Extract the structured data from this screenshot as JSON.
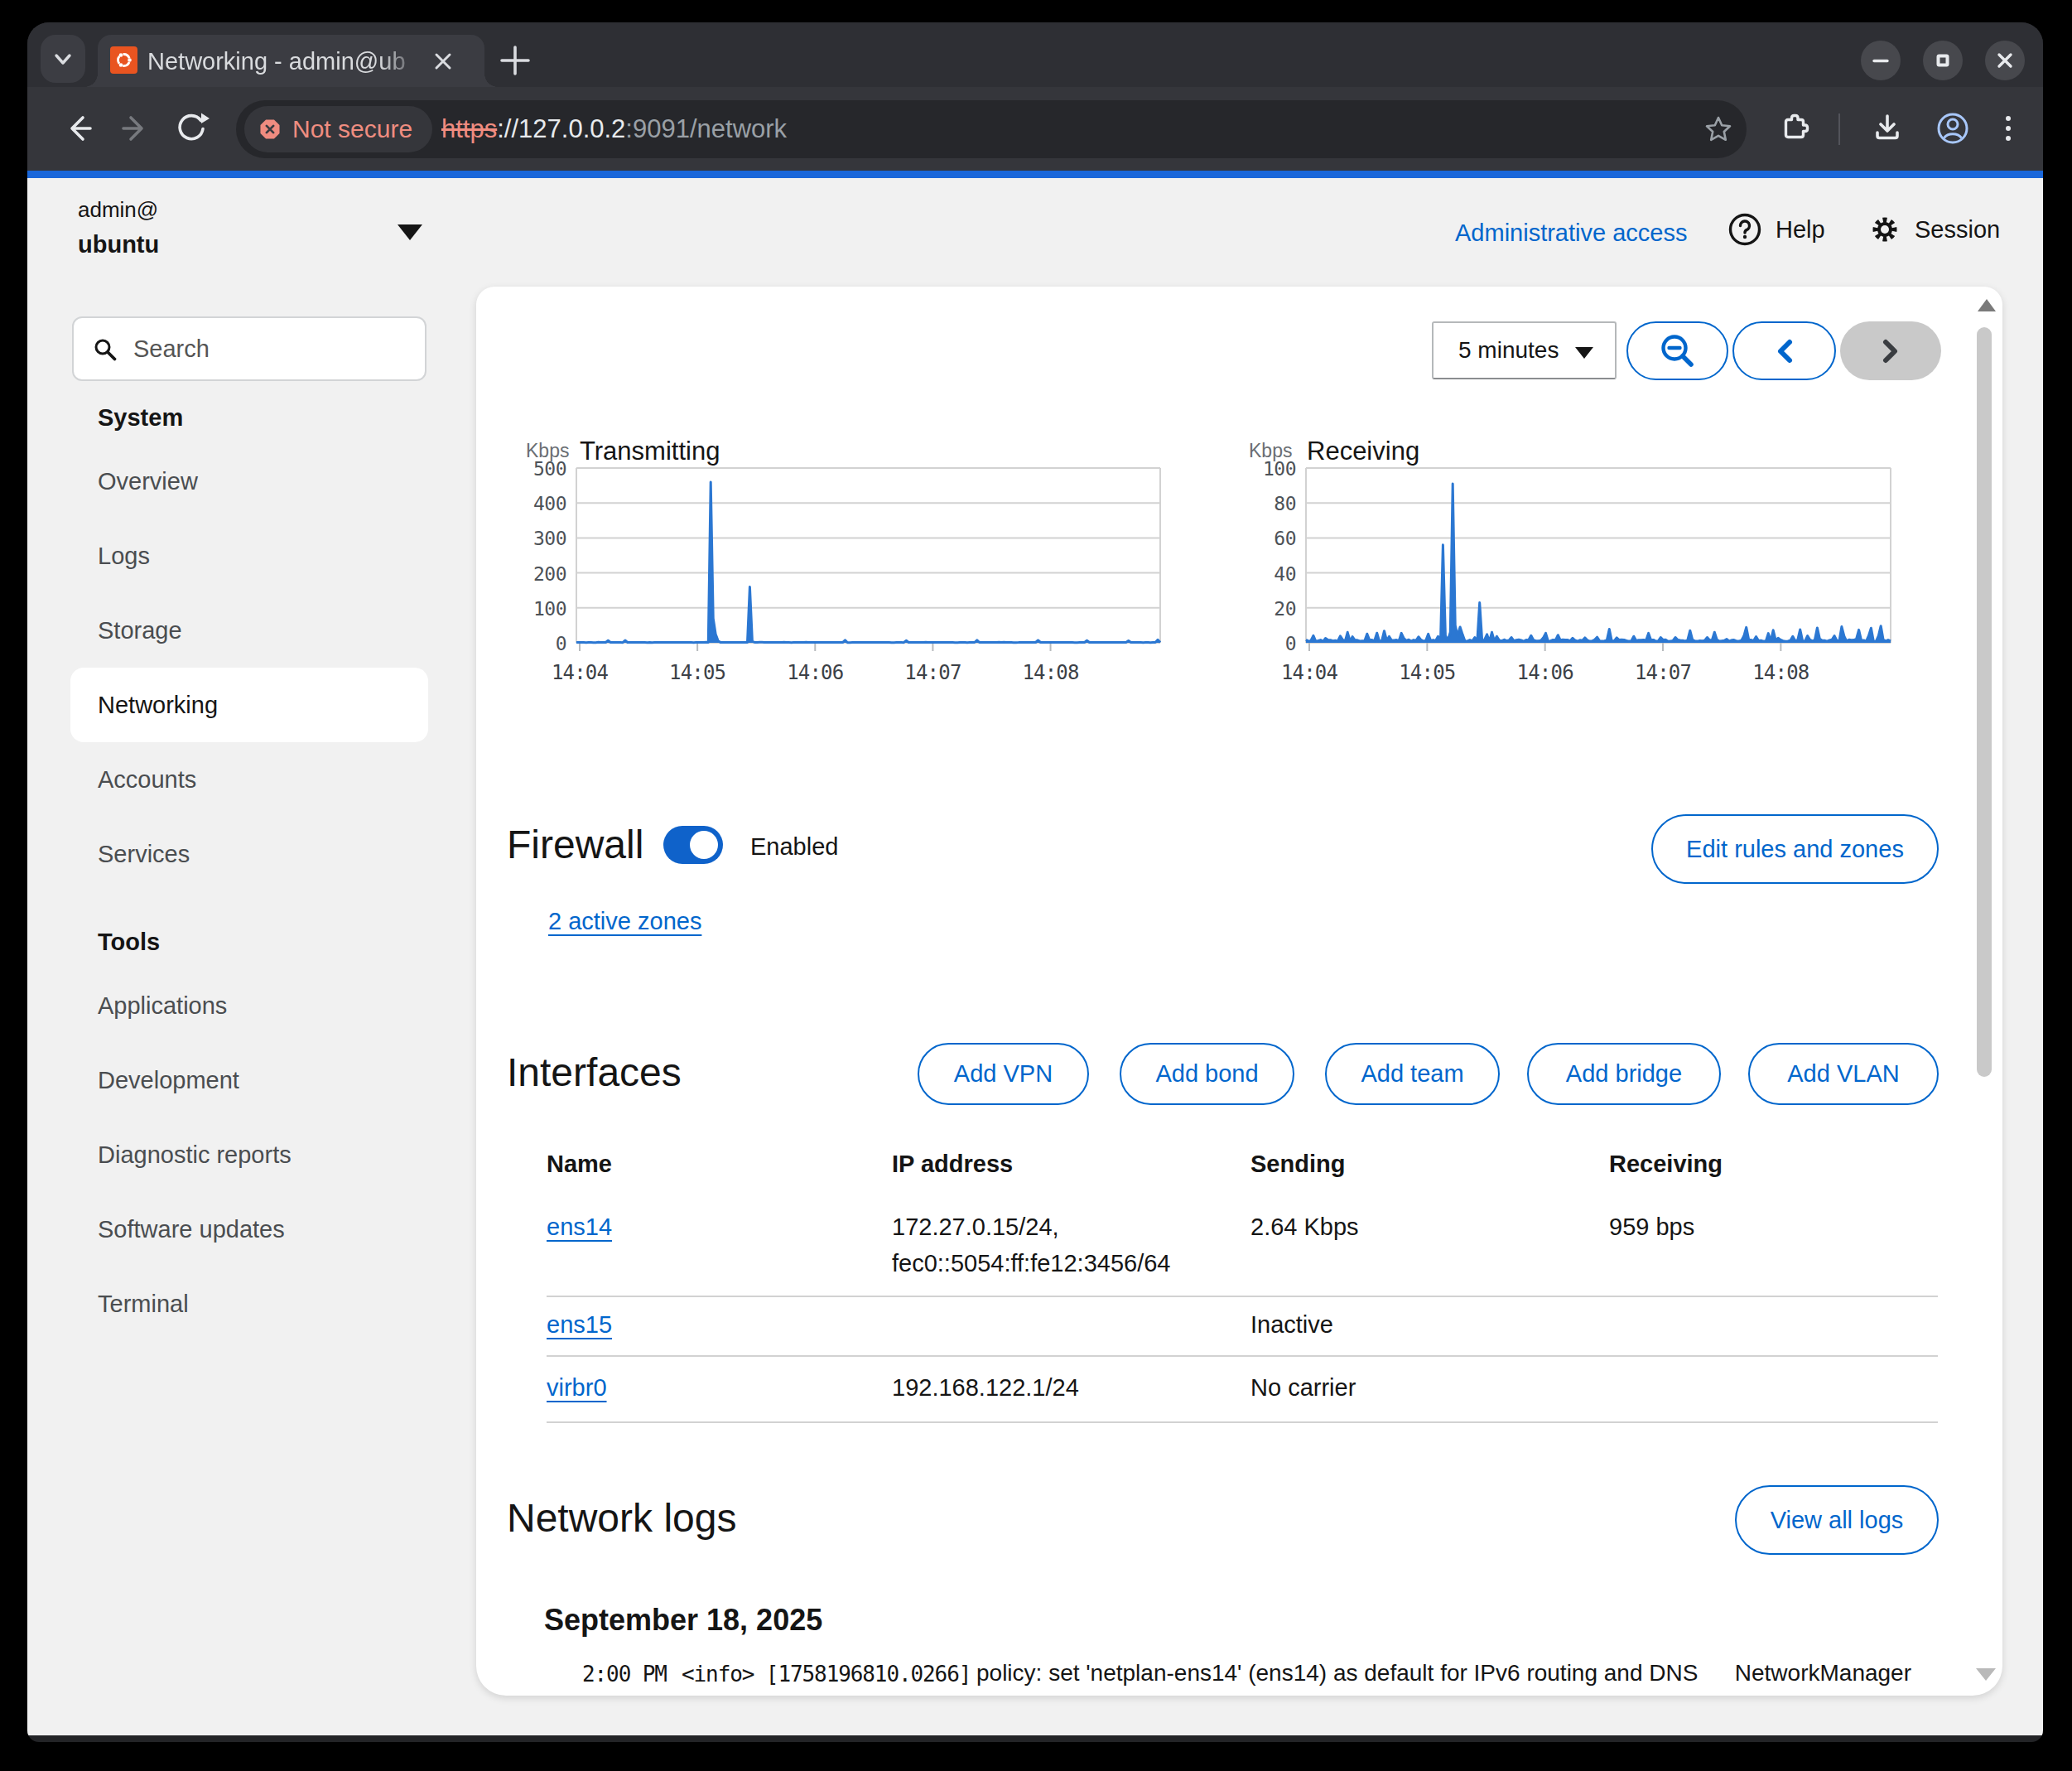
{
  "browser": {
    "tab_title": "Networking - admin@ub",
    "new_tab_label": "+",
    "not_secure_label": "Not secure",
    "url": {
      "scheme": "https",
      "host": "://127.0.0.2",
      "rest": ":9091/network"
    }
  },
  "masthead": {
    "user_line1": "admin@",
    "user_line2": "ubuntu",
    "admin_access_label": "Administrative access",
    "help_label": "Help",
    "session_label": "Session"
  },
  "sidebar": {
    "search_placeholder": "Search",
    "sections": [
      {
        "title": "System",
        "items": [
          {
            "label": "Overview",
            "selected": false
          },
          {
            "label": "Logs",
            "selected": false
          },
          {
            "label": "Storage",
            "selected": false
          },
          {
            "label": "Networking",
            "selected": true
          },
          {
            "label": "Accounts",
            "selected": false
          },
          {
            "label": "Services",
            "selected": false
          }
        ]
      },
      {
        "title": "Tools",
        "items": [
          {
            "label": "Applications",
            "selected": false
          },
          {
            "label": "Development",
            "selected": false
          },
          {
            "label": "Diagnostic reports",
            "selected": false
          },
          {
            "label": "Software updates",
            "selected": false
          },
          {
            "label": "Terminal",
            "selected": false
          }
        ]
      }
    ]
  },
  "graph_controls": {
    "interval_label": "5 minutes",
    "zoom_out_button": "zoom-out",
    "back_button": "previous",
    "forward_button": "next"
  },
  "chart_data": [
    {
      "type": "area",
      "title": "Transmitting",
      "ylabel": "Kbps",
      "ylim": [
        0,
        500
      ],
      "yticks": [
        0,
        100,
        200,
        300,
        400,
        500
      ],
      "xticklabels": [
        "14:04",
        "14:05",
        "14:06",
        "14:07",
        "14:08"
      ],
      "x_span_minutes": 5,
      "grid": true,
      "values": [
        1.4,
        1.4,
        1.2,
        1.0,
        0.8,
        1.1,
        1.1,
        0.8,
        0.8,
        1.6,
        1.3,
        1.0,
        1.1,
        6.5,
        1.5,
        1.5,
        1.1,
        1.2,
        1.3,
        0.8,
        7.0,
        1.0,
        1.5,
        0.9,
        1.3,
        1.5,
        1.0,
        1.5,
        1.5,
        0.8,
        1.4,
        0.8,
        1.2,
        1.1,
        1.0,
        1.1,
        1.4,
        1.1,
        0.9,
        1.4,
        1.2,
        1.4,
        1.0,
        1.1,
        1.4,
        1.2,
        1.2,
        1.0,
        0.8,
        1.5,
        0.9,
        1.5,
        1.1,
        1.6,
        1.1,
        460.0,
        70.0,
        25.0,
        6.0,
        1.3,
        1.3,
        1.2,
        1.0,
        1.3,
        0.9,
        1.4,
        1.3,
        1.1,
        1.4,
        1.0,
        1.1,
        160.0,
        4.0,
        1.4,
        1.3,
        1.6,
        1.6,
        1.4,
        1.4,
        0.9,
        1.4,
        1.5,
        1.1,
        1.2,
        1.2,
        1.6,
        1.1,
        1.1,
        0.8,
        1.1,
        1.3,
        1.5,
        1.5,
        1.1,
        1.6,
        1.0,
        1.5,
        0.9,
        1.1,
        0.9,
        1.5,
        1.5,
        0.9,
        1.2,
        1.0,
        1.2,
        1.2,
        0.9,
        1.5,
        1.0,
        7.5,
        0.8,
        0.8,
        1.0,
        1.1,
        1.5,
        1.5,
        1.2,
        1.2,
        1.3,
        1.5,
        1.1,
        1.4,
        1.1,
        1.3,
        1.4,
        1.2,
        1.4,
        1.4,
        0.8,
        0.8,
        0.9,
        1.0,
        1.0,
        0.8,
        6.5,
        1.3,
        1.5,
        1.1,
        1.1,
        1.1,
        1.3,
        1.4,
        1.6,
        1.1,
        1.4,
        1.1,
        1.5,
        1.0,
        1.5,
        1.2,
        1.4,
        1.2,
        1.1,
        1.2,
        0.8,
        0.8,
        1.2,
        1.2,
        1.5,
        0.8,
        1.2,
        1.2,
        1.3,
        7.5,
        1.2,
        1.3,
        1.2,
        1.3,
        1.0,
        1.2,
        1.3,
        1.0,
        1.6,
        1.4,
        1.6,
        1.0,
        1.2,
        1.0,
        0.8,
        0.8,
        1.0,
        1.5,
        0.9,
        1.4,
        1.0,
        0.9,
        1.0,
        1.3,
        7.0,
        1.2,
        1.2,
        1.0,
        1.2,
        1.5,
        1.0,
        1.4,
        1.0,
        1.0,
        1.1,
        0.9,
        1.5,
        1.1,
        0.9,
        0.8,
        0.8,
        1.0,
        1.1,
        1.3,
        6.5,
        1.5,
        1.0,
        1.3,
        1.5,
        0.9,
        1.5,
        1.1,
        1.4,
        1.1,
        1.3,
        1.2,
        0.9,
        1.4,
        1.5,
        1.2,
        1.1,
        6.0,
        1.1,
        1.5,
        1.1,
        1.1,
        1.1,
        0.8,
        1.0,
        1.0,
        0.8,
        1.2,
        1.2,
        8.5,
        0.9
      ]
    },
    {
      "type": "area",
      "title": "Receiving",
      "ylabel": "Kbps",
      "ylim": [
        0,
        100
      ],
      "yticks": [
        0,
        20,
        40,
        60,
        80,
        100
      ],
      "xticklabels": [
        "14:04",
        "14:05",
        "14:06",
        "14:07",
        "14:08"
      ],
      "x_span_minutes": 5,
      "grid": true,
      "values": [
        1.7,
        0.9,
        1.2,
        4.1,
        0.9,
        1.2,
        1.6,
        0.8,
        2.6,
        1.7,
        1.5,
        1.1,
        1.3,
        1.0,
        3.9,
        1.7,
        0.9,
        6.0,
        1.0,
        3.5,
        1.5,
        1.5,
        1.0,
        1.1,
        1.2,
        5.1,
        1.5,
        1.6,
        1.1,
        5.6,
        0.9,
        1.2,
        6.8,
        1.3,
        3.6,
        1.4,
        1.4,
        1.6,
        1.1,
        5.5,
        2.5,
        1.3,
        1.8,
        0.9,
        1.6,
        1.3,
        3.4,
        1.7,
        0.9,
        1.3,
        5.0,
        1.1,
        1.6,
        1.2,
        3.7,
        0.8,
        56.0,
        4.0,
        1.5,
        6.0,
        91.0,
        10.0,
        4.0,
        9.0,
        4.7,
        1.0,
        1.0,
        1.6,
        1.0,
        3.1,
        0.8,
        23.0,
        0.9,
        1.7,
        4.8,
        0.8,
        6.0,
        1.0,
        3.7,
        1.4,
        1.0,
        1.8,
        1.2,
        1.4,
        3.1,
        1.1,
        1.5,
        1.8,
        1.4,
        0.9,
        1.6,
        1.5,
        4.1,
        1.5,
        1.1,
        1.1,
        1.3,
        2.8,
        5.5,
        1.0,
        1.1,
        1.7,
        1.4,
        4.4,
        1.5,
        1.8,
        1.7,
        1.6,
        1.1,
        2.7,
        1.4,
        0.9,
        1.5,
        1.3,
        2.9,
        1.5,
        0.9,
        1.0,
        1.8,
        3.2,
        1.1,
        0.9,
        1.1,
        1.4,
        7.8,
        1.1,
        1.1,
        2.9,
        1.6,
        1.8,
        1.7,
        1.2,
        0.9,
        1.1,
        3.7,
        1.2,
        1.5,
        1.5,
        1.7,
        1.3,
        5.5,
        1.7,
        1.7,
        0.9,
        1.0,
        3.1,
        1.6,
        1.8,
        0.8,
        1.0,
        1.2,
        3.1,
        1.6,
        1.4,
        1.3,
        1.0,
        1.5,
        7.0,
        1.7,
        1.0,
        0.9,
        1.2,
        1.1,
        1.3,
        3.1,
        1.5,
        1.6,
        6.0,
        1.7,
        0.9,
        1.1,
        1.3,
        2.1,
        1.0,
        1.5,
        1.6,
        1.0,
        1.0,
        1.3,
        3.9,
        8.8,
        1.7,
        1.6,
        1.2,
        3.5,
        1.2,
        1.3,
        0.9,
        0.8,
        5.4,
        1.0,
        7.2,
        1.4,
        2.7,
        1.7,
        1.1,
        0.8,
        1.0,
        1.3,
        3.7,
        1.1,
        1.5,
        7.6,
        1.1,
        1.0,
        4.0,
        1.8,
        1.0,
        1.6,
        8.6,
        2.3,
        1.3,
        1.3,
        0.9,
        1.4,
        1.8,
        4.0,
        1.3,
        1.2,
        9.2,
        3.7,
        1.0,
        1.8,
        1.5,
        1.6,
        2.2,
        7.4,
        1.3,
        1.4,
        0.9,
        4.0,
        8.4,
        0.9,
        0.8,
        3.8,
        9.6,
        1.7,
        1.0,
        1.6,
        1.0
      ]
    }
  ],
  "firewall": {
    "title": "Firewall",
    "toggle_on": true,
    "state_label": "Enabled",
    "edit_button": "Edit rules and zones",
    "zones_link": "2 active zones"
  },
  "interfaces": {
    "title": "Interfaces",
    "actions": [
      "Add VPN",
      "Add bond",
      "Add team",
      "Add bridge",
      "Add VLAN"
    ],
    "table": {
      "headers": [
        "Name",
        "IP address",
        "Sending",
        "Receiving"
      ],
      "rows": [
        {
          "name": "ens14",
          "ip": [
            "172.27.0.15/24,",
            "fec0::5054:ff:fe12:3456/64"
          ],
          "sending": "2.64 Kbps",
          "receiving": "959 bps"
        },
        {
          "name": "ens15",
          "ip": [],
          "sending": "Inactive",
          "receiving": ""
        },
        {
          "name": "virbr0",
          "ip": [
            "192.168.122.1/24"
          ],
          "sending": "No carrier",
          "receiving": ""
        }
      ]
    }
  },
  "network_logs": {
    "title": "Network logs",
    "view_all_button": "View all logs",
    "date": "September 18, 2025",
    "entries": [
      {
        "time": "2:00 PM",
        "prefix": "<info> [1758196810.0266]",
        "message": "policy: set 'netplan-ens14' (ens14) as default for IPv6 routing and DNS",
        "service": "NetworkManager"
      }
    ]
  },
  "colors": {
    "accent_blue": "#0066cc",
    "chart_blue": "#2b77d2",
    "loading_bar_blue": "#1a67da",
    "ubuntu_orange": "#e95420",
    "warning_red": "#f08c80",
    "page_bg": "#f1f1f1"
  }
}
